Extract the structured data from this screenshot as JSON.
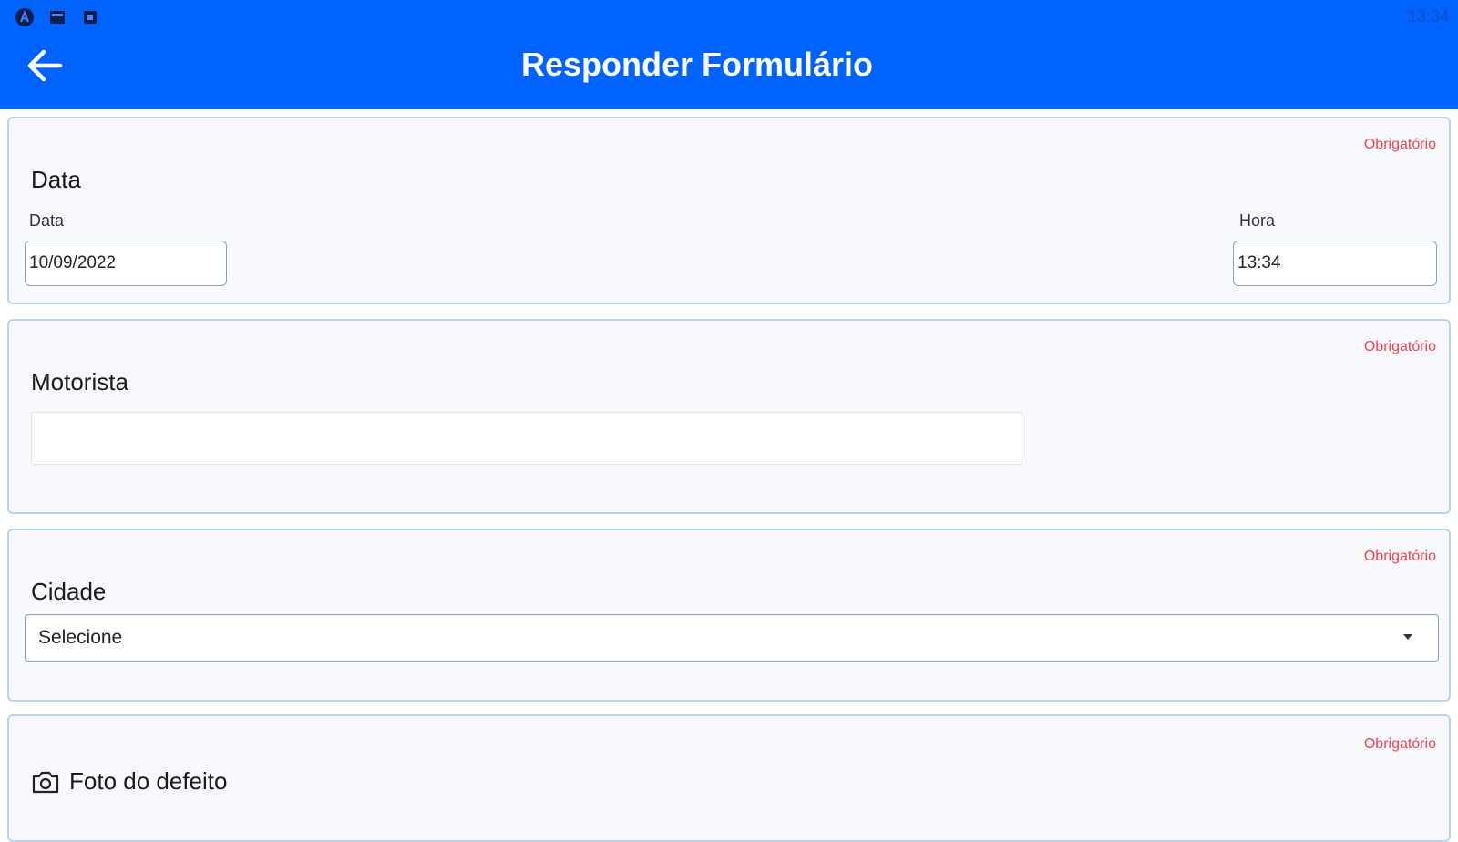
{
  "status_bar": {
    "time": "13:34",
    "icons": [
      "app-icon",
      "screenshot-icon",
      "notification-icon"
    ]
  },
  "header": {
    "title": "Responder Formulário",
    "back_icon": "arrow-left-icon"
  },
  "colors": {
    "appbar": "#0062ff",
    "card_border": "#b5d5f4",
    "required": "#f0424f"
  },
  "form": {
    "required_label": "Obrigatório",
    "data_section": {
      "title": "Data",
      "date_label": "Data",
      "date_value": "10/09/2022",
      "time_label": "Hora",
      "time_value": "13:34"
    },
    "motorista_section": {
      "title": "Motorista",
      "value": ""
    },
    "cidade_section": {
      "title": "Cidade",
      "selected": "Selecione",
      "caret_icon": "dropdown-caret-icon"
    },
    "foto_section": {
      "title": "Foto do defeito",
      "icon": "camera-icon"
    }
  }
}
